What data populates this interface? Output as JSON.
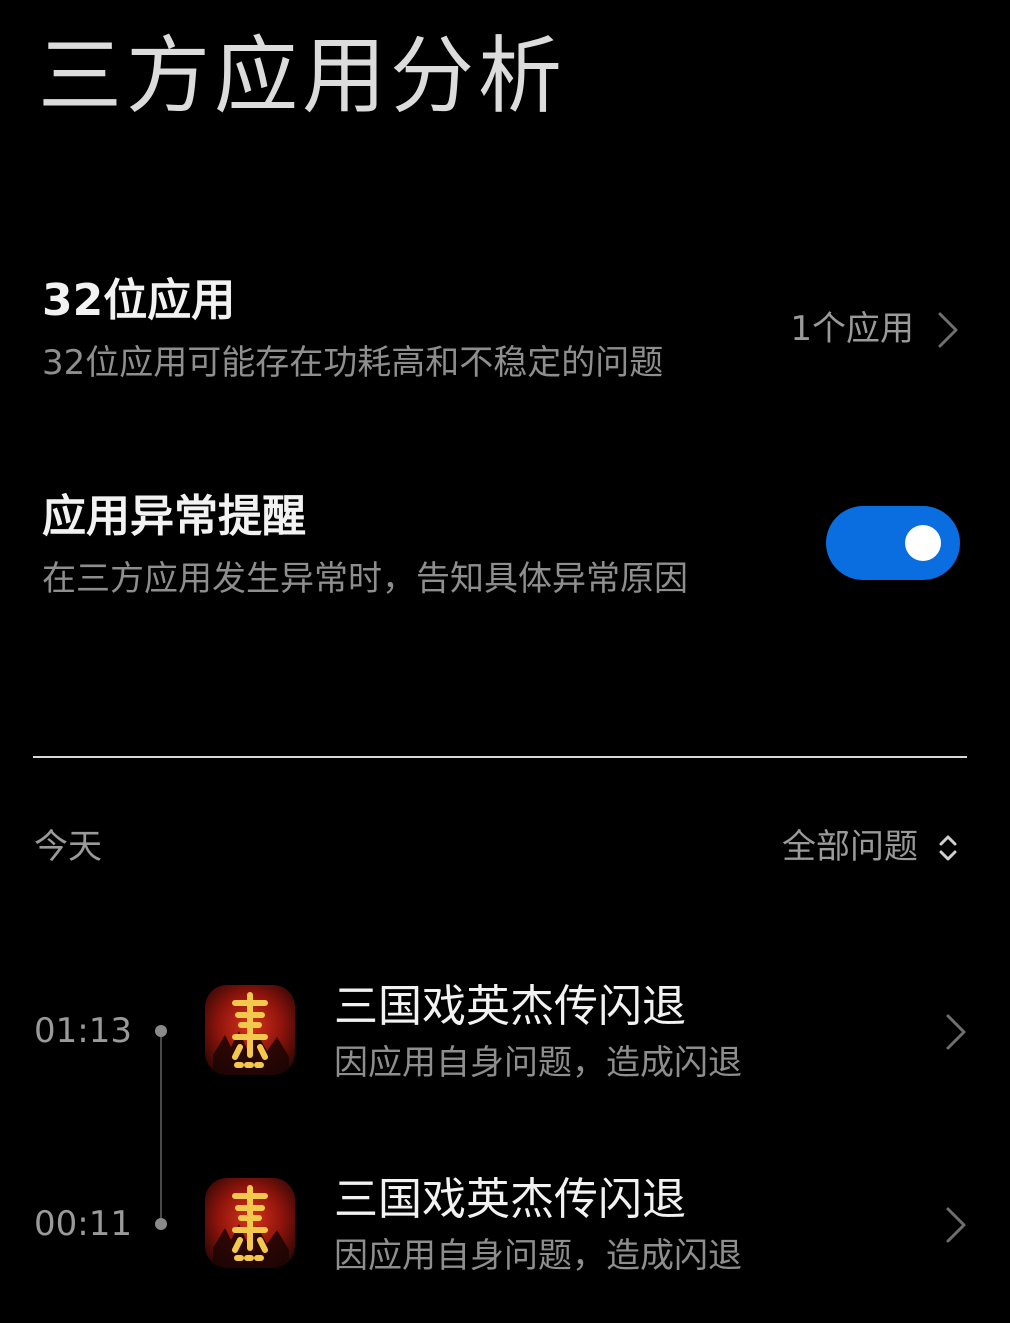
{
  "page": {
    "title": "三方应用分析"
  },
  "settings": {
    "app_32bit": {
      "title": "32位应用",
      "description": "32位应用可能存在功耗高和不稳定的问题",
      "value": "1个应用"
    },
    "anomaly_alert": {
      "title": "应用异常提醒",
      "description": "在三方应用发生异常时，告知具体异常原因",
      "enabled": true
    }
  },
  "history": {
    "date_label": "今天",
    "filter_label": "全部问题",
    "events": [
      {
        "time": "01:13",
        "title": "三国戏英杰传闪退",
        "description": "因应用自身问题，造成闪退"
      },
      {
        "time": "00:11",
        "title": "三国戏英杰传闪退",
        "description": "因应用自身问题，造成闪退"
      }
    ]
  },
  "icons": {
    "chevron": "chevron-right-icon",
    "sort": "sort-updown-icon",
    "app": "sanguo-app-icon"
  },
  "colors": {
    "background": "#000000",
    "toggle_on": "#0a6ee0",
    "primary_text": "#f2f2f2",
    "secondary_text": "#8e8e8e"
  }
}
